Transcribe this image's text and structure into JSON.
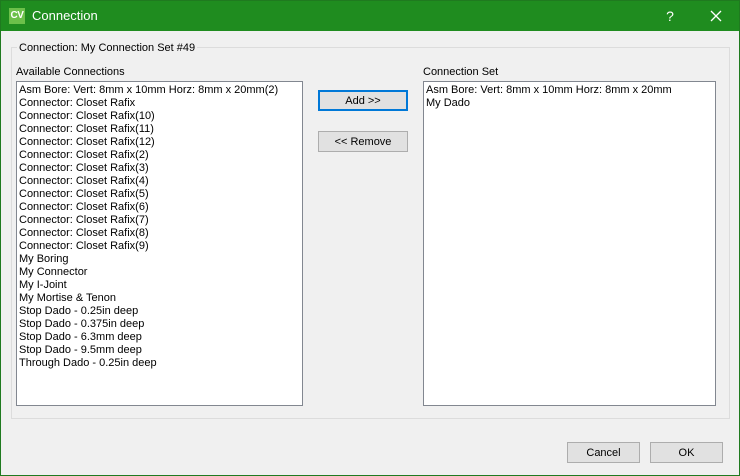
{
  "window": {
    "icon_text": "CV",
    "title": "Connection",
    "help_glyph": "?"
  },
  "group": {
    "label": "Connection: My Connection Set #49"
  },
  "available": {
    "label": "Available Connections",
    "items": [
      "Asm Bore: Vert: 8mm x 10mm Horz: 8mm x 20mm(2)",
      "Connector: Closet Rafix",
      "Connector: Closet Rafix(10)",
      "Connector: Closet Rafix(11)",
      "Connector: Closet Rafix(12)",
      "Connector: Closet Rafix(2)",
      "Connector: Closet Rafix(3)",
      "Connector: Closet Rafix(4)",
      "Connector: Closet Rafix(5)",
      "Connector: Closet Rafix(6)",
      "Connector: Closet Rafix(7)",
      "Connector: Closet Rafix(8)",
      "Connector: Closet Rafix(9)",
      "My Boring",
      "My Connector",
      "My I-Joint",
      "My Mortise & Tenon",
      "Stop Dado - 0.25in deep",
      "Stop Dado - 0.375in deep",
      "Stop Dado - 6.3mm deep",
      "Stop Dado - 9.5mm deep",
      "Through Dado - 0.25in deep"
    ]
  },
  "connection_set": {
    "label": "Connection Set",
    "items": [
      "Asm Bore: Vert: 8mm x 10mm Horz: 8mm x 20mm",
      "My Dado"
    ]
  },
  "buttons": {
    "add": "Add >>",
    "remove": "<< Remove",
    "cancel": "Cancel",
    "ok": "OK"
  },
  "colors": {
    "titlebar": "#1f8c1f",
    "app_icon": "#6cc04a",
    "default_button_border": "#0078d7"
  }
}
